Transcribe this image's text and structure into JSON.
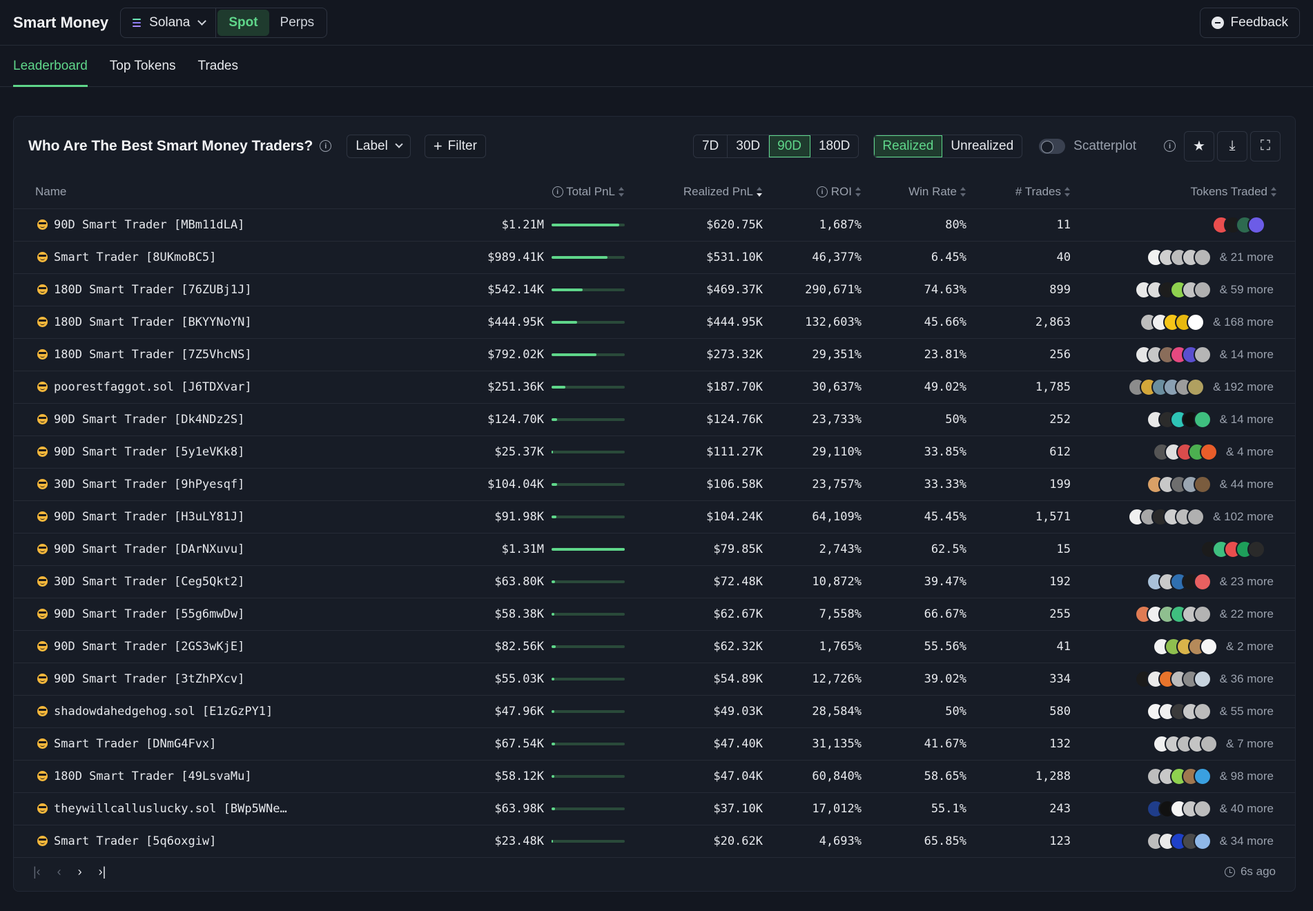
{
  "app": {
    "title": "Smart Money"
  },
  "chain": {
    "label": "Solana"
  },
  "market_toggle": {
    "options": [
      "Spot",
      "Perps"
    ],
    "selected": "Spot"
  },
  "feedback": {
    "label": "Feedback"
  },
  "nav": {
    "tabs": [
      "Leaderboard",
      "Top Tokens",
      "Trades"
    ],
    "active": "Leaderboard"
  },
  "panel": {
    "title": "Who Are The Best Smart Money Traders?",
    "label_dropdown": "Label",
    "filter_button": "Filter",
    "timeframes": [
      "7D",
      "30D",
      "90D",
      "180D"
    ],
    "timeframe_selected": "90D",
    "pnl_modes": [
      "Realized",
      "Unrealized"
    ],
    "pnl_mode_selected": "Realized",
    "scatterplot_label": "Scatterplot",
    "scatterplot_on": false
  },
  "table": {
    "headers": {
      "name": "Name",
      "total_pnl": "Total PnL",
      "realized_pnl": "Realized PnL",
      "roi": "ROI",
      "win_rate": "Win Rate",
      "trades": "# Trades",
      "tokens": "Tokens Traded"
    },
    "sorted_by": "Realized PnL",
    "rows": [
      {
        "name": "90D Smart Trader [MBm11dLA]",
        "total_pnl": "$1.21M",
        "pnl_level": 0.92,
        "realized": "$620.75K",
        "roi": "1,687%",
        "win_rate": "80%",
        "trades": "11",
        "token_colors": [
          "#e94e4e",
          "#1b1b1b",
          "#2d6a4f",
          "#6c5ce7"
        ],
        "more": ""
      },
      {
        "name": "Smart Trader [8UKmoBC5]",
        "total_pnl": "$989.41K",
        "pnl_level": 0.76,
        "realized": "$531.10K",
        "roi": "46,377%",
        "win_rate": "6.45%",
        "trades": "40",
        "token_colors": [
          "#f1f1f1",
          "#cfcfcf",
          "#bdbdbd",
          "#c9c9c9",
          "#b8b8b8"
        ],
        "more": "& 21 more"
      },
      {
        "name": "180D Smart Trader [76ZUBj1J]",
        "total_pnl": "$542.14K",
        "pnl_level": 0.42,
        "realized": "$469.37K",
        "roi": "290,671%",
        "win_rate": "74.63%",
        "trades": "899",
        "token_colors": [
          "#e9e9e9",
          "#dcdcdc",
          "#1d1d1d",
          "#8fd14f",
          "#c2c2c2",
          "#b0b0b0"
        ],
        "more": "& 59 more"
      },
      {
        "name": "180D Smart Trader [BKYYNoYN]",
        "total_pnl": "$444.95K",
        "pnl_level": 0.35,
        "realized": "$444.95K",
        "roi": "132,603%",
        "win_rate": "45.66%",
        "trades": "2,863",
        "token_colors": [
          "#bdbdbd",
          "#f0f0f0",
          "#f5c518",
          "#e8b90f",
          "#ffffff"
        ],
        "more": "& 168 more"
      },
      {
        "name": "180D Smart Trader [7Z5VhcNS]",
        "total_pnl": "$792.02K",
        "pnl_level": 0.61,
        "realized": "$273.32K",
        "roi": "29,351%",
        "win_rate": "23.81%",
        "trades": "256",
        "token_colors": [
          "#e6e6e6",
          "#c7c7c7",
          "#8a6d5a",
          "#e64980",
          "#5a4fcf",
          "#b5b5b5"
        ],
        "more": "& 14 more"
      },
      {
        "name": "poorestfaggot.sol [J6TDXvar]",
        "total_pnl": "$251.36K",
        "pnl_level": 0.19,
        "realized": "$187.70K",
        "roi": "30,637%",
        "win_rate": "49.02%",
        "trades": "1,785",
        "token_colors": [
          "#8c8c8c",
          "#d4a73a",
          "#6b8e9f",
          "#8aa0b3",
          "#9c9c9c",
          "#b0a060"
        ],
        "more": "& 192 more"
      },
      {
        "name": "90D Smart Trader [Dk4NDz2S]",
        "total_pnl": "$124.70K",
        "pnl_level": 0.08,
        "realized": "$124.76K",
        "roi": "23,733%",
        "win_rate": "50%",
        "trades": "252",
        "token_colors": [
          "#e8e8e8",
          "#2b2b2b",
          "#2ec4b6",
          "#111111",
          "#3fbf7f"
        ],
        "more": "& 14 more"
      },
      {
        "name": "90D Smart Trader [5y1eVKk8]",
        "total_pnl": "$25.37K",
        "pnl_level": 0.02,
        "realized": "$111.27K",
        "roi": "29,110%",
        "win_rate": "33.85%",
        "trades": "612",
        "token_colors": [
          "#555555",
          "#e0e0e0",
          "#d94c4c",
          "#4caf50",
          "#e85d2a"
        ],
        "more": "& 4 more"
      },
      {
        "name": "30D Smart Trader [9hPyesqf]",
        "total_pnl": "$104.04K",
        "pnl_level": 0.08,
        "realized": "$106.58K",
        "roi": "23,757%",
        "win_rate": "33.33%",
        "trades": "199",
        "token_colors": [
          "#d9a066",
          "#c8c8c8",
          "#6e6e6e",
          "#9aa6b2",
          "#7a5c3e"
        ],
        "more": "& 44 more"
      },
      {
        "name": "90D Smart Trader [H3uLY81J]",
        "total_pnl": "$91.98K",
        "pnl_level": 0.07,
        "realized": "$104.24K",
        "roi": "64,109%",
        "win_rate": "45.45%",
        "trades": "1,571",
        "token_colors": [
          "#f0f0f0",
          "#a8a8a8",
          "#2a2a2a",
          "#cfcfcf",
          "#bcbcbc",
          "#b0b0b0"
        ],
        "more": "& 102 more"
      },
      {
        "name": "90D Smart Trader [DArNXuvu]",
        "total_pnl": "$1.31M",
        "pnl_level": 1.0,
        "realized": "$79.85K",
        "roi": "2,743%",
        "win_rate": "62.5%",
        "trades": "15",
        "token_colors": [
          "#1b1b1b",
          "#3fbf7f",
          "#e94e4e",
          "#1e9e5a",
          "#2a2a2a"
        ],
        "more": ""
      },
      {
        "name": "30D Smart Trader [Ceg5Qkt2]",
        "total_pnl": "$63.80K",
        "pnl_level": 0.05,
        "realized": "$72.48K",
        "roi": "10,872%",
        "win_rate": "39.47%",
        "trades": "192",
        "token_colors": [
          "#a9c1d9",
          "#c9c9c9",
          "#2f6fb0",
          "#1b1b1b",
          "#e86060"
        ],
        "more": "& 23 more"
      },
      {
        "name": "90D Smart Trader [55g6mwDw]",
        "total_pnl": "$58.38K",
        "pnl_level": 0.04,
        "realized": "$62.67K",
        "roi": "7,558%",
        "win_rate": "66.67%",
        "trades": "255",
        "token_colors": [
          "#e07b53",
          "#f0f0f0",
          "#8fbf8f",
          "#3fbf7f",
          "#c4c4c4",
          "#b3b3b3"
        ],
        "more": "& 22 more"
      },
      {
        "name": "90D Smart Trader [2GS3wKjE]",
        "total_pnl": "$82.56K",
        "pnl_level": 0.06,
        "realized": "$62.32K",
        "roi": "1,765%",
        "win_rate": "55.56%",
        "trades": "41",
        "token_colors": [
          "#f2f2f2",
          "#8fbf4f",
          "#d9b44a",
          "#b58a5a",
          "#f5f5f5"
        ],
        "more": "& 2 more"
      },
      {
        "name": "90D Smart Trader [3tZhPXcv]",
        "total_pnl": "$55.03K",
        "pnl_level": 0.04,
        "realized": "$54.89K",
        "roi": "12,726%",
        "win_rate": "39.02%",
        "trades": "334",
        "token_colors": [
          "#1b1b1b",
          "#eaeaea",
          "#e8742c",
          "#bdbdbd",
          "#8a8a8a",
          "#c7d3de"
        ],
        "more": "& 36 more"
      },
      {
        "name": "shadowdahedgehog.sol [E1zGzPY1]",
        "total_pnl": "$47.96K",
        "pnl_level": 0.04,
        "realized": "$49.03K",
        "roi": "28,584%",
        "win_rate": "50%",
        "trades": "580",
        "token_colors": [
          "#f5f5f5",
          "#f0f0f0",
          "#3a3a3a",
          "#c8c8c8",
          "#bbbbbb"
        ],
        "more": "& 55 more"
      },
      {
        "name": "Smart Trader [DNmG4Fvx]",
        "total_pnl": "$67.54K",
        "pnl_level": 0.05,
        "realized": "$47.40K",
        "roi": "31,135%",
        "win_rate": "41.67%",
        "trades": "132",
        "token_colors": [
          "#f0f0f0",
          "#cccccc",
          "#bdbdbd",
          "#c4c4c4",
          "#b8b8b8"
        ],
        "more": "& 7 more"
      },
      {
        "name": "180D Smart Trader [49LsvaMu]",
        "total_pnl": "$58.12K",
        "pnl_level": 0.04,
        "realized": "$47.04K",
        "roi": "60,840%",
        "win_rate": "58.65%",
        "trades": "1,288",
        "token_colors": [
          "#bdbdbd",
          "#c8c8c8",
          "#8fd14f",
          "#a07850",
          "#3aa0e0"
        ],
        "more": "& 98 more"
      },
      {
        "name": "theywillcalluslucky.sol [BWp5WNe…",
        "total_pnl": "$63.98K",
        "pnl_level": 0.05,
        "realized": "$37.10K",
        "roi": "17,012%",
        "win_rate": "55.1%",
        "trades": "243",
        "token_colors": [
          "#1f3d8a",
          "#111111",
          "#f5f5f5",
          "#c8c8c8",
          "#bcbcbc"
        ],
        "more": "& 40 more"
      },
      {
        "name": "Smart Trader [5q6oxgiw]",
        "total_pnl": "$23.48K",
        "pnl_level": 0.02,
        "realized": "$20.62K",
        "roi": "4,693%",
        "win_rate": "65.85%",
        "trades": "123",
        "token_colors": [
          "#bdbdbd",
          "#eaeaea",
          "#1e40c8",
          "#4a4a4a",
          "#8fb8e8"
        ],
        "more": "& 34 more"
      }
    ]
  },
  "footer": {
    "updated": "6s ago"
  },
  "colors": {
    "accent": "#5fd68a",
    "background": "#131720",
    "panel": "#171c26"
  }
}
